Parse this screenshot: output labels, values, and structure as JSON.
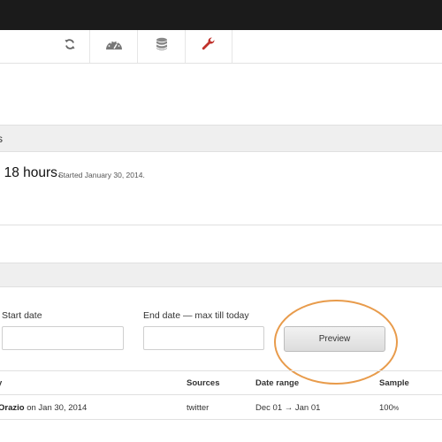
{
  "toolbar": {
    "icons": [
      "refresh-icon",
      "dashboard-gauge-icon",
      "database-icon",
      "wrench-icon"
    ],
    "accent_color": "#c0312b"
  },
  "section1": {
    "title_fragment": "s"
  },
  "status": {
    "main_text": ": 18 hours.",
    "started_text": "Started January 30, 2014."
  },
  "form": {
    "start_label": "Start date",
    "start_value": "",
    "end_label": "End date — max till today",
    "end_value": "",
    "preview_label": "Preview",
    "highlight_color": "#e89b4b"
  },
  "table": {
    "headers": [
      "y",
      "Sources",
      "Date range",
      "Sample"
    ],
    "rows": [
      {
        "author": "Orazio",
        "created": "on Jan 30, 2014",
        "sources": "twitter",
        "date_range": "Dec 01 → Jan 01",
        "sample": "100",
        "sample_unit": "%"
      }
    ]
  }
}
